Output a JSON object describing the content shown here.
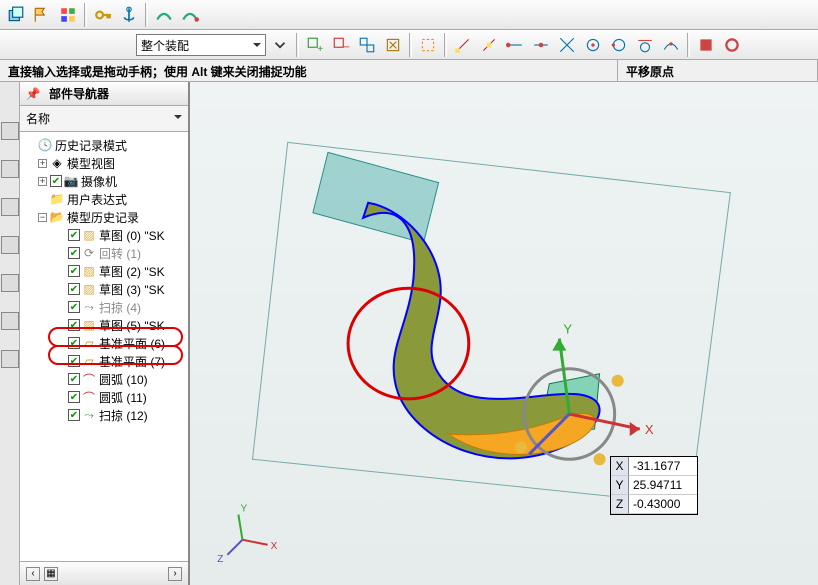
{
  "toolbar": {
    "assembly_dropdown": "整个装配"
  },
  "status": {
    "left": "直接输入选择或是拖动手柄；使用 Alt 键来关闭捕捉功能",
    "right": "平移原点"
  },
  "panel": {
    "title": "部件导航器",
    "column": "名称"
  },
  "tree": {
    "n0": "历史记录模式",
    "n1": "模型视图",
    "n2": "摄像机",
    "n3": "用户表达式",
    "n4": "模型历史记录",
    "c0": "草图 (0) \"SK",
    "c1": "回转 (1)",
    "c2": "草图 (2) \"SK",
    "c3": "草图 (3) \"SK",
    "c4": "扫掠 (4)",
    "c5": "草图 (5) \"SK",
    "c6": "基准平面 (6)",
    "c7": "基准平面 (7)",
    "c8": "圆弧 (10)",
    "c9": "圆弧 (11)",
    "c10": "扫掠 (12)"
  },
  "coords": {
    "xlabel": "X",
    "x": "-31.1677",
    "ylabel": "Y",
    "y": "25.94711",
    "zlabel": "Z",
    "z": "-0.43000"
  },
  "axes": {
    "x": "X",
    "y": "Y",
    "z": "Z"
  }
}
